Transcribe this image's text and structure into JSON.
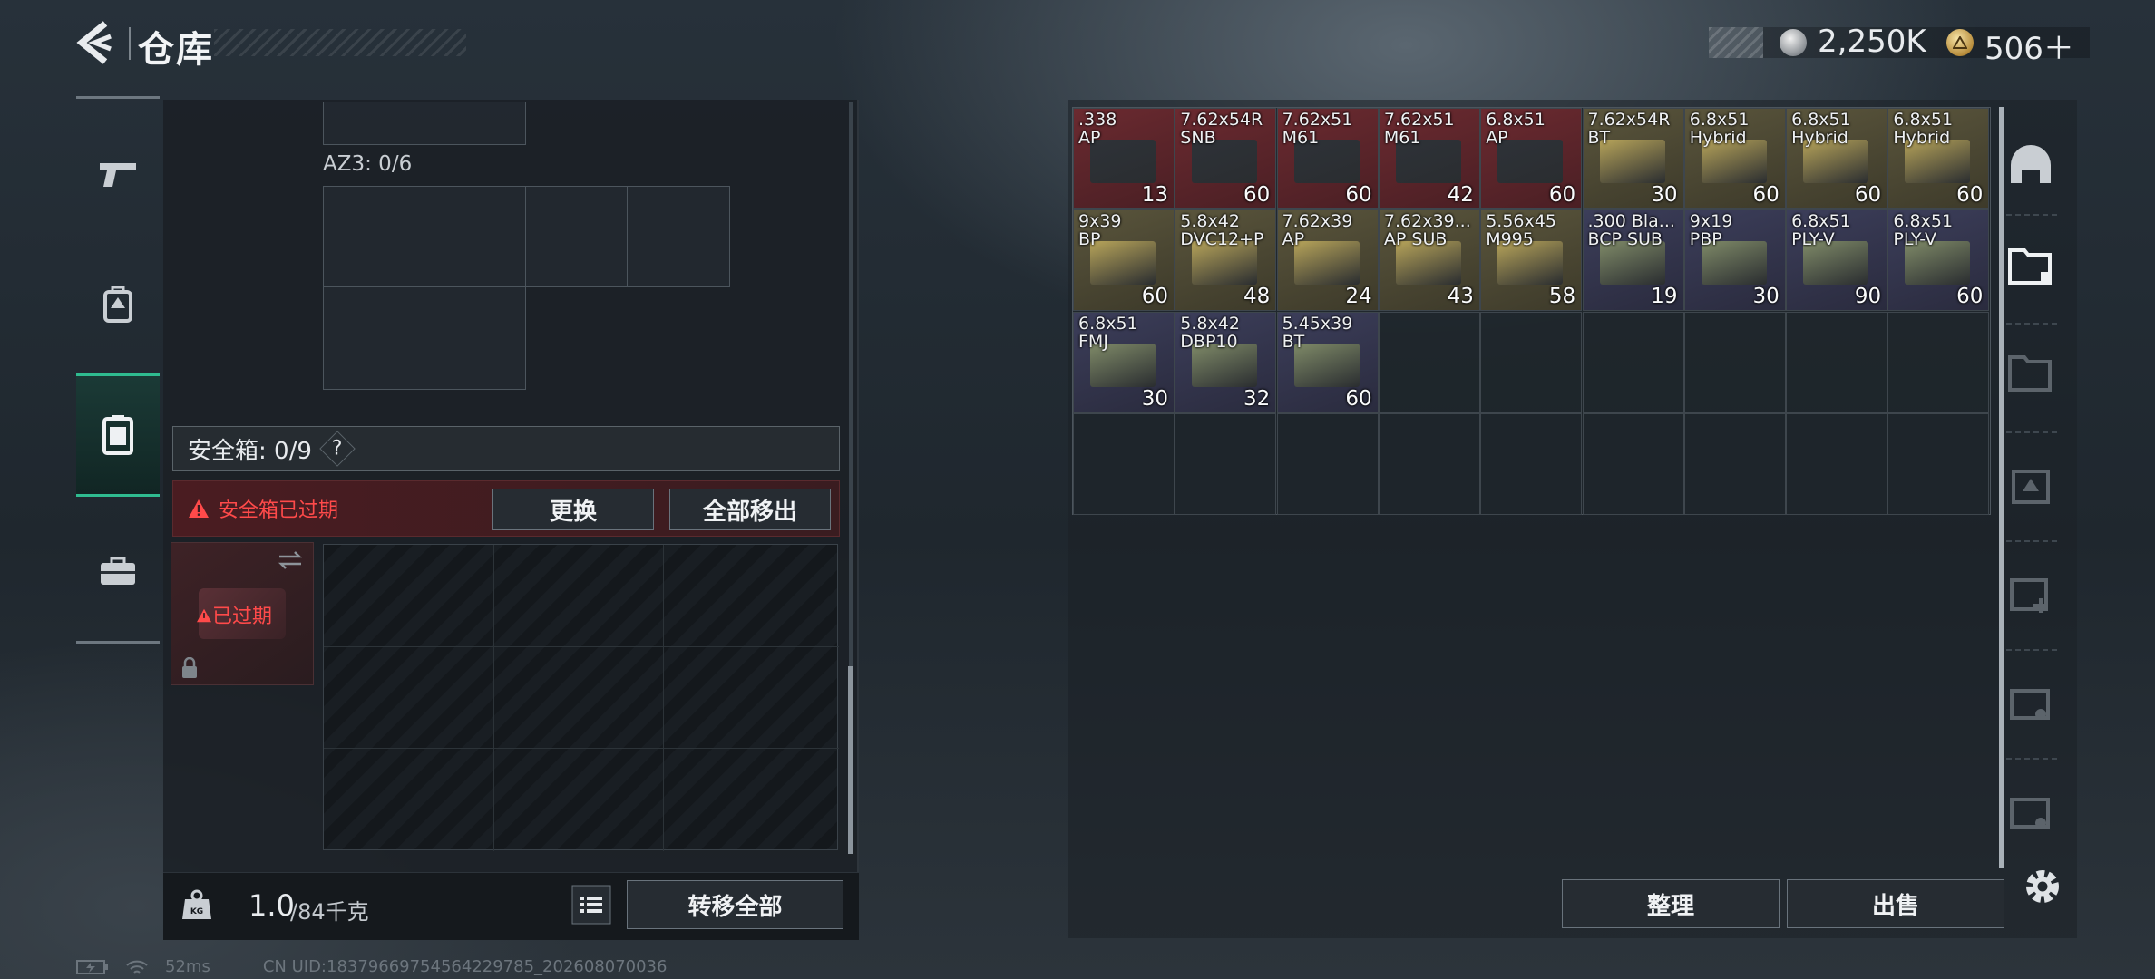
{
  "header": {
    "title": "仓库",
    "silver": "2,250K",
    "gold": "506＋"
  },
  "left_panel": {
    "az3_label": "AZ3: 0/6",
    "safe_label": "安全箱: 0/9",
    "safe_help": "?",
    "alert": "安全箱已过期",
    "btn_replace": "更换",
    "btn_remove_all": "全部移出",
    "expired": "已过期",
    "weight_value": "1.0",
    "weight_unit": "/84千克",
    "btn_transfer_all": "转移全部"
  },
  "inventory": {
    "items": [
      {
        "name": ".338\nAP",
        "count": "13",
        "bg": "red"
      },
      {
        "name": "7.62x54R\nSNB",
        "count": "60",
        "bg": "red"
      },
      {
        "name": "7.62x51\nM61",
        "count": "60",
        "bg": "red"
      },
      {
        "name": "7.62x51\nM61",
        "count": "42",
        "bg": "red"
      },
      {
        "name": "6.8x51\nAP",
        "count": "60",
        "bg": "red"
      },
      {
        "name": "7.62x54R\nBT",
        "count": "30",
        "bg": "olive"
      },
      {
        "name": "6.8x51\nHybrid",
        "count": "60",
        "bg": "olive"
      },
      {
        "name": "6.8x51\nHybrid",
        "count": "60",
        "bg": "olive"
      },
      {
        "name": "6.8x51\nHybrid",
        "count": "60",
        "bg": "olive"
      },
      {
        "name": "9x39\nBP",
        "count": "60",
        "bg": "olive"
      },
      {
        "name": "5.8x42\nDVC12+P",
        "count": "48",
        "bg": "olive"
      },
      {
        "name": "7.62x39\nAP",
        "count": "24",
        "bg": "olive"
      },
      {
        "name": "7.62x39...\nAP SUB",
        "count": "43",
        "bg": "olive"
      },
      {
        "name": "5.56x45\nM995",
        "count": "58",
        "bg": "olive"
      },
      {
        "name": ".300 Bla...\nBCP SUB",
        "count": "19",
        "bg": "blue"
      },
      {
        "name": "9x19\nPBP",
        "count": "30",
        "bg": "blue"
      },
      {
        "name": "6.8x51\nPLY-V",
        "count": "90",
        "bg": "blue"
      },
      {
        "name": "6.8x51\nPLY-V",
        "count": "60",
        "bg": "blue"
      },
      {
        "name": "6.8x51\nFMJ",
        "count": "30",
        "bg": "blue"
      },
      {
        "name": "5.8x42\nDBP10",
        "count": "32",
        "bg": "blue"
      },
      {
        "name": "5.45x39\nBT",
        "count": "60",
        "bg": "blue"
      }
    ]
  },
  "right_buttons": {
    "sort": "整理",
    "sell": "出售"
  },
  "status": {
    "ping": "52ms",
    "uid": "CN UID:1837966975456422978­5_202608070036"
  },
  "colors": {
    "accent": "#2fbc90",
    "alert": "#ff4a4a",
    "red_tier": "#6b2a30",
    "olive_tier": "#5a553c",
    "blue_tier": "#3c3e5a"
  }
}
